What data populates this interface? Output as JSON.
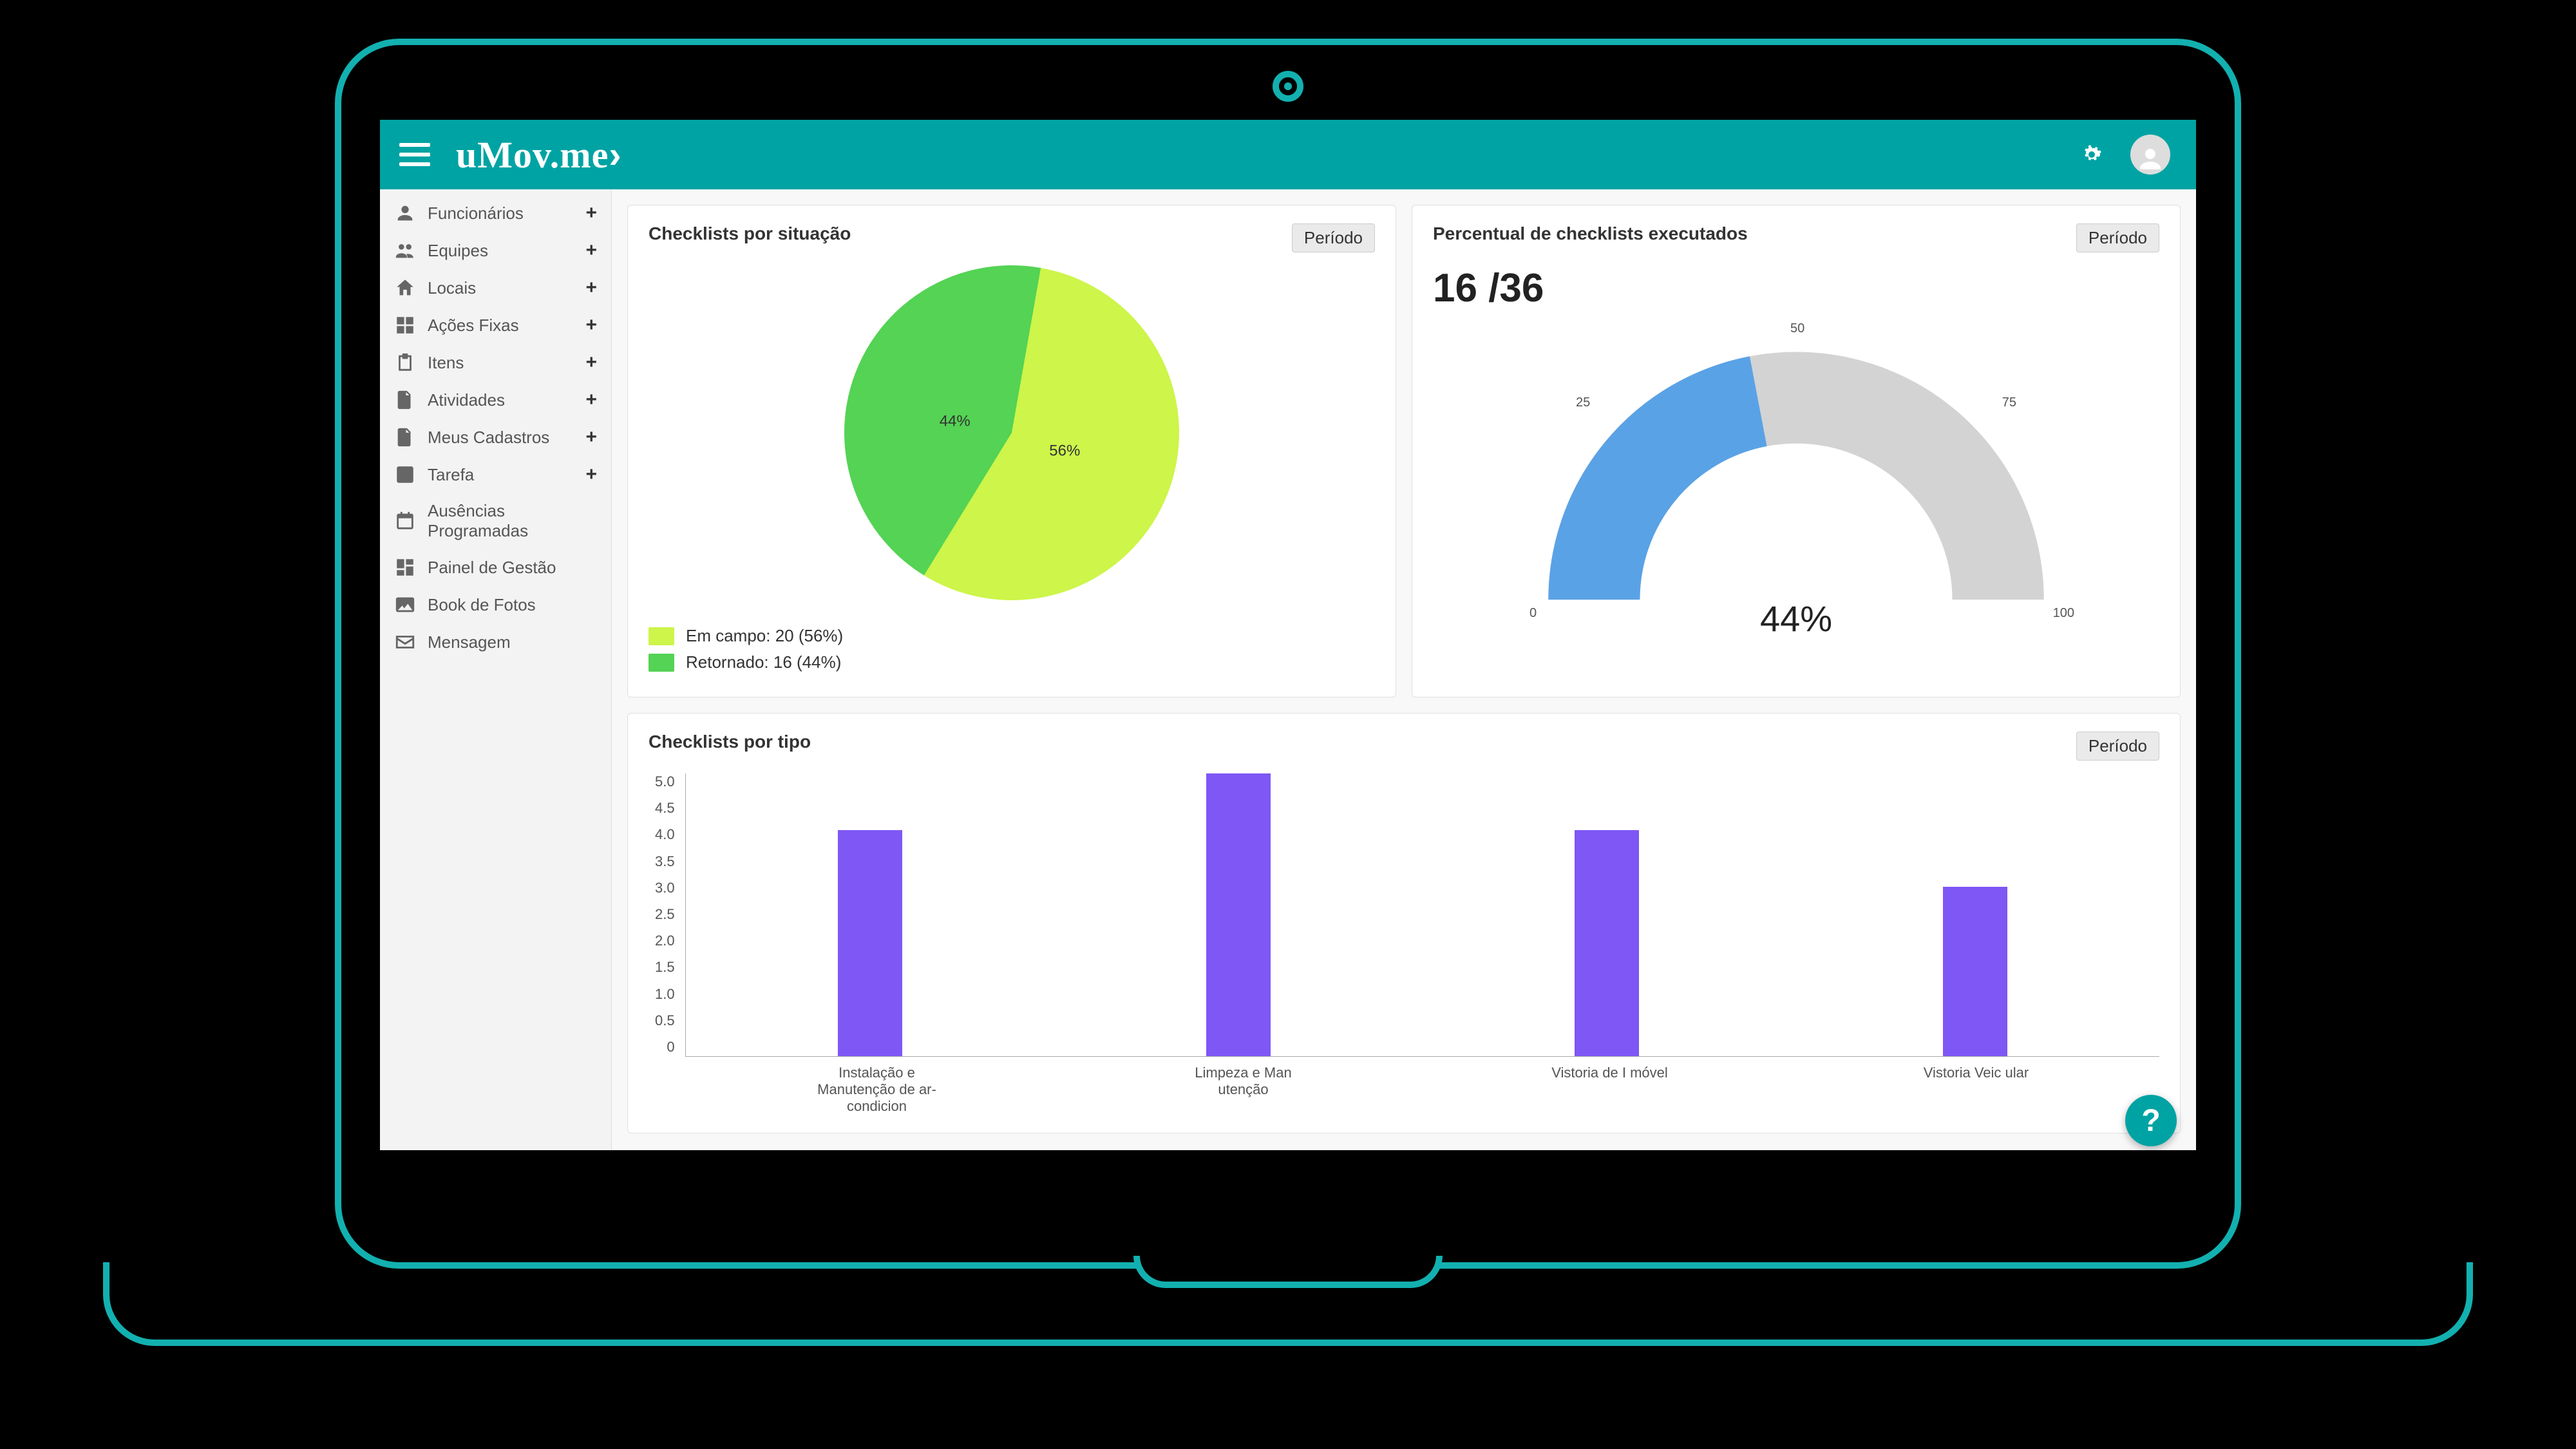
{
  "brand": {
    "name": "uMov.me",
    "arrow": "›"
  },
  "header": {
    "menu_icon": "menu-icon",
    "gear_icon": "gear-icon",
    "avatar": "avatar"
  },
  "sidebar": {
    "items": [
      {
        "label": "Funcionários",
        "icon": "person-icon",
        "plus": true
      },
      {
        "label": "Equipes",
        "icon": "people-icon",
        "plus": true
      },
      {
        "label": "Locais",
        "icon": "home-icon",
        "plus": true
      },
      {
        "label": "Ações Fixas",
        "icon": "grid-icon",
        "plus": true
      },
      {
        "label": "Itens",
        "icon": "clipboard-icon",
        "plus": true
      },
      {
        "label": "Atividades",
        "icon": "document-icon",
        "plus": true
      },
      {
        "label": "Meus Cadastros",
        "icon": "file-icon",
        "plus": true
      },
      {
        "label": "Tarefa",
        "icon": "checklist-icon",
        "plus": true
      },
      {
        "label": "Ausências Programadas",
        "icon": "calendar-icon",
        "plus": false
      },
      {
        "label": "Painel de Gestão",
        "icon": "dashboard-icon",
        "plus": false
      },
      {
        "label": "Book de Fotos",
        "icon": "photos-icon",
        "plus": false
      },
      {
        "label": "Mensagem",
        "icon": "mail-icon",
        "plus": false
      }
    ]
  },
  "cards": {
    "pie": {
      "title": "Checklists por situação",
      "period_btn": "Período"
    },
    "gauge": {
      "title": "Percentual de checklists executados",
      "period_btn": "Período",
      "count": "16 /36",
      "percent_label": "44%"
    },
    "bar": {
      "title": "Checklists por tipo",
      "period_btn": "Período"
    }
  },
  "help_label": "?",
  "chart_data": [
    {
      "id": "pie",
      "type": "pie",
      "title": "Checklists por situação",
      "series": [
        {
          "name": "Em campo",
          "value": 20,
          "percent": 56,
          "color": "#cdf54a",
          "label_in_slice": "56%",
          "legend_label": "Em campo: 20 (56%)"
        },
        {
          "name": "Retornado",
          "value": 16,
          "percent": 44,
          "color": "#54d354",
          "label_in_slice": "44%",
          "legend_label": "Retornado: 16 (44%)"
        }
      ]
    },
    {
      "id": "gauge",
      "type": "gauge",
      "title": "Percentual de checklists executados",
      "value": 44,
      "completed": 16,
      "total": 36,
      "min": 0,
      "max": 100,
      "ticks": [
        0,
        25,
        50,
        75,
        100
      ],
      "fill_color": "#5aa2e6",
      "track_color": "#d3d3d3"
    },
    {
      "id": "bar",
      "type": "bar",
      "title": "Checklists por tipo",
      "ylim": [
        0,
        5
      ],
      "y_ticks": [
        0,
        0.5,
        1.0,
        1.5,
        2.0,
        2.5,
        3.0,
        3.5,
        4.0,
        4.5,
        5.0
      ],
      "color": "#7e57f5",
      "categories": [
        "Instalação e Manutenção de ar-condicion",
        "Limpeza e Man utenção",
        "Vistoria de I móvel",
        "Vistoria Veic ular"
      ],
      "values": [
        4,
        5,
        4,
        3
      ]
    }
  ]
}
